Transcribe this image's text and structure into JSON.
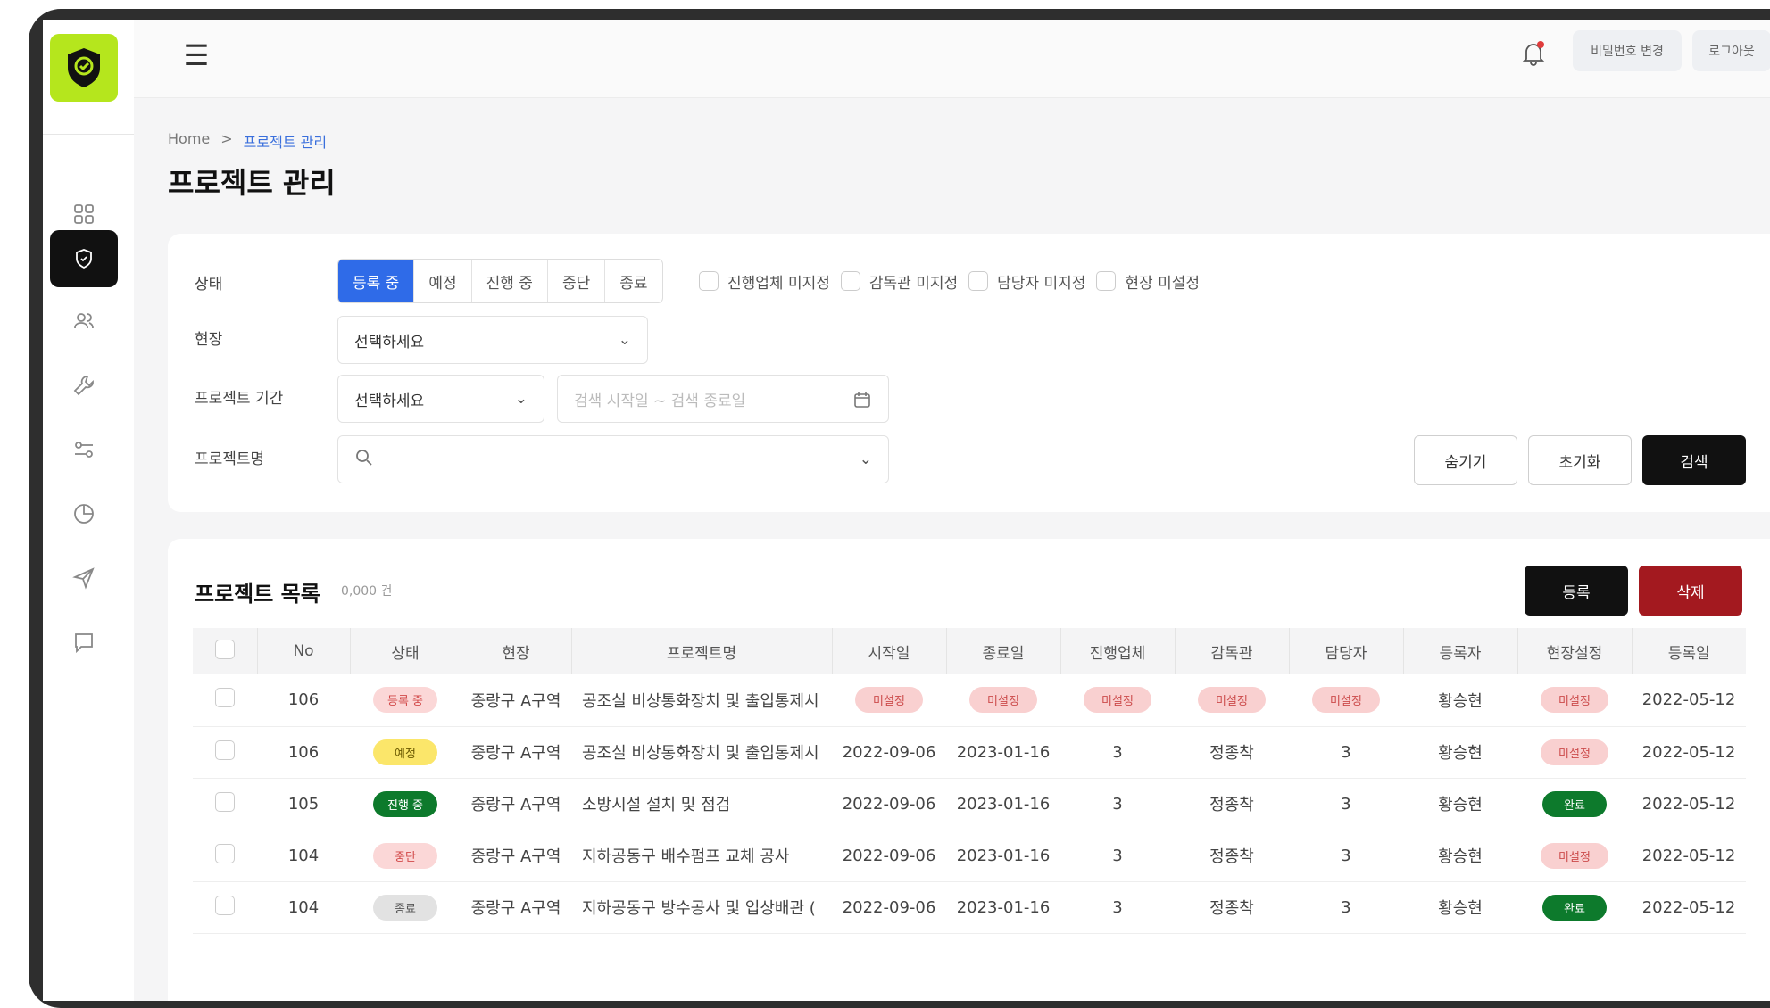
{
  "topbar": {
    "change_password": "비밀번호 변경",
    "logout": "로그아웃"
  },
  "breadcrumb": {
    "home": "Home",
    "separator": ">",
    "current": "프로젝트 관리"
  },
  "page_title": "프로젝트 관리",
  "filters": {
    "status_label": "상태",
    "status_options": [
      "등록 중",
      "예정",
      "진행 중",
      "중단",
      "종료"
    ],
    "status_selected": "등록 중",
    "checkboxes": [
      "진행업체 미지정",
      "감독관 미지정",
      "담당자 미지정",
      "현장 미설정"
    ],
    "site_label": "현장",
    "site_value": "선택하세요",
    "period_label": "프로젝트 기간",
    "period_value": "선택하세요",
    "date_placeholder": "검색 시작일 ~ 검색 종료일",
    "name_label": "프로젝트명",
    "hide_button": "숨기기",
    "reset_button": "초기화",
    "search_button": "검색"
  },
  "list": {
    "title": "프로젝트 목록",
    "count": "0,000 건",
    "register_button": "등록",
    "delete_button": "삭제",
    "columns": [
      "No",
      "상태",
      "현장",
      "프로젝트명",
      "시작일",
      "종료일",
      "진행업체",
      "감독관",
      "담당자",
      "등록자",
      "현장설정",
      "등록일"
    ],
    "rows": [
      {
        "no": "106",
        "status": "등록 중",
        "status_color": "red",
        "site": "중랑구 A구역",
        "name": "공조실 비상통화장치 및 출입통제시",
        "start": "미설정",
        "end": "미설정",
        "vendor": "미설정",
        "supervisor": "미설정",
        "manager": "미설정",
        "registrant": "황승현",
        "site_setting": "미설정",
        "reg_date": "2022-05-12"
      },
      {
        "no": "106",
        "status": "예정",
        "status_color": "yellow",
        "site": "중랑구 A구역",
        "name": "공조실 비상통화장치 및 출입통제시",
        "start": "2022-09-06",
        "end": "2023-01-16",
        "vendor": "3",
        "supervisor": "정종착",
        "manager": "3",
        "registrant": "황승현",
        "site_setting": "미설정",
        "reg_date": "2022-05-12"
      },
      {
        "no": "105",
        "status": "진행 중",
        "status_color": "green",
        "site": "중랑구 A구역",
        "name": "소방시설 설치 및 점검",
        "start": "2022-09-06",
        "end": "2023-01-16",
        "vendor": "3",
        "supervisor": "정종착",
        "manager": "3",
        "registrant": "황승현",
        "site_setting": "완료",
        "reg_date": "2022-05-12"
      },
      {
        "no": "104",
        "status": "중단",
        "status_color": "red",
        "site": "중랑구 A구역",
        "name": "지하공동구 배수펌프 교체 공사",
        "start": "2022-09-06",
        "end": "2023-01-16",
        "vendor": "3",
        "supervisor": "정종착",
        "manager": "3",
        "registrant": "황승현",
        "site_setting": "미설정",
        "reg_date": "2022-05-12"
      },
      {
        "no": "104",
        "status": "종료",
        "status_color": "gray",
        "site": "중랑구 A구역",
        "name": "지하공동구 방수공사 및 입상배관 (",
        "start": "2022-09-06",
        "end": "2023-01-16",
        "vendor": "3",
        "supervisor": "정종착",
        "manager": "3",
        "registrant": "황승현",
        "site_setting": "완료",
        "reg_date": "2022-05-12"
      }
    ]
  },
  "sidebar": {
    "items": [
      "grid-icon",
      "shield-icon",
      "users-icon",
      "wrench-icon",
      "sliders-icon",
      "pie-chart-icon",
      "send-icon",
      "chat-icon"
    ],
    "active": "shield-icon"
  }
}
